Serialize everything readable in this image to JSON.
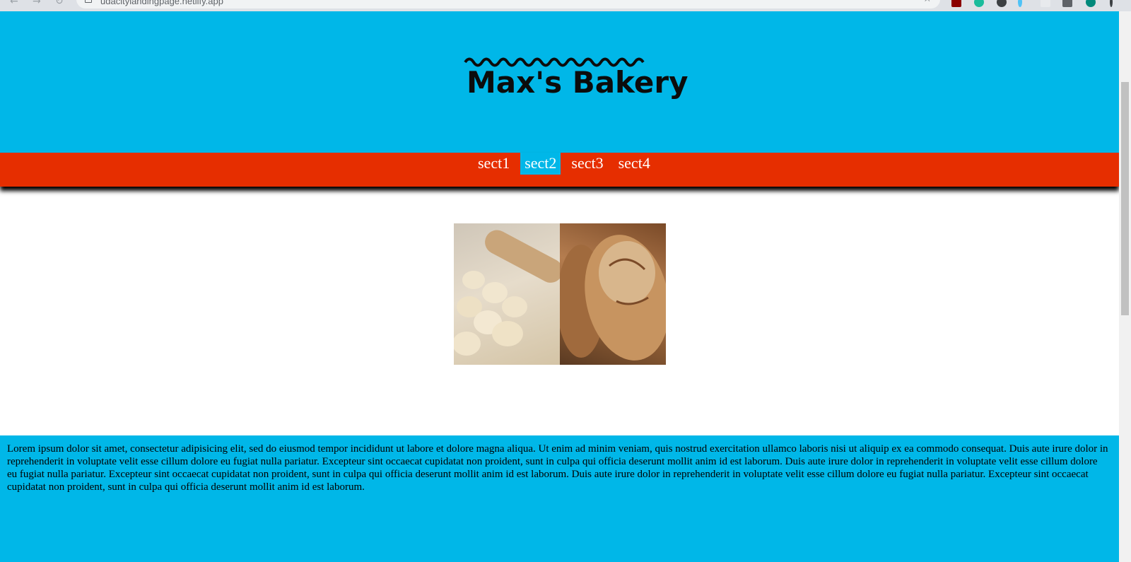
{
  "browser": {
    "url": "udacitylandingpage.netlify.app",
    "back_icon": "arrow-left-icon",
    "forward_icon": "arrow-right-icon",
    "reload_icon": "reload-icon",
    "bookmark_icon": "star-icon"
  },
  "header": {
    "logo_text": "Max's Bakery",
    "background": "#00b7e8"
  },
  "nav": {
    "background": "#e62e00",
    "items": [
      {
        "label": "sect1",
        "active": false
      },
      {
        "label": "sect2",
        "active": true
      },
      {
        "label": "sect3",
        "active": false
      },
      {
        "label": "sect4",
        "active": false
      }
    ]
  },
  "hero_image": {
    "alt_left": "dough balls and rolling pin",
    "alt_right": "bread loaves"
  },
  "section": {
    "background": "#00b7e8",
    "text": "Lorem ipsum dolor sit amet, consectetur adipisicing elit, sed do eiusmod tempor incididunt ut labore et dolore magna aliqua. Ut enim ad minim veniam, quis nostrud exercitation ullamco laboris nisi ut aliquip ex ea commodo consequat. Duis aute irure dolor in reprehenderit in voluptate velit esse cillum dolore eu fugiat nulla pariatur. Excepteur sint occaecat cupidatat non proident, sunt in culpa qui officia deserunt mollit anim id est laborum. Duis aute irure dolor in reprehenderit in voluptate velit esse cillum dolore eu fugiat nulla pariatur. Excepteur sint occaecat cupidatat non proident, sunt in culpa qui officia deserunt mollit anim id est laborum. Duis aute irure dolor in reprehenderit in voluptate velit esse cillum dolore eu fugiat nulla pariatur. Excepteur sint occaecat cupidatat non proident, sunt in culpa qui officia deserunt mollit anim id est laborum."
  }
}
